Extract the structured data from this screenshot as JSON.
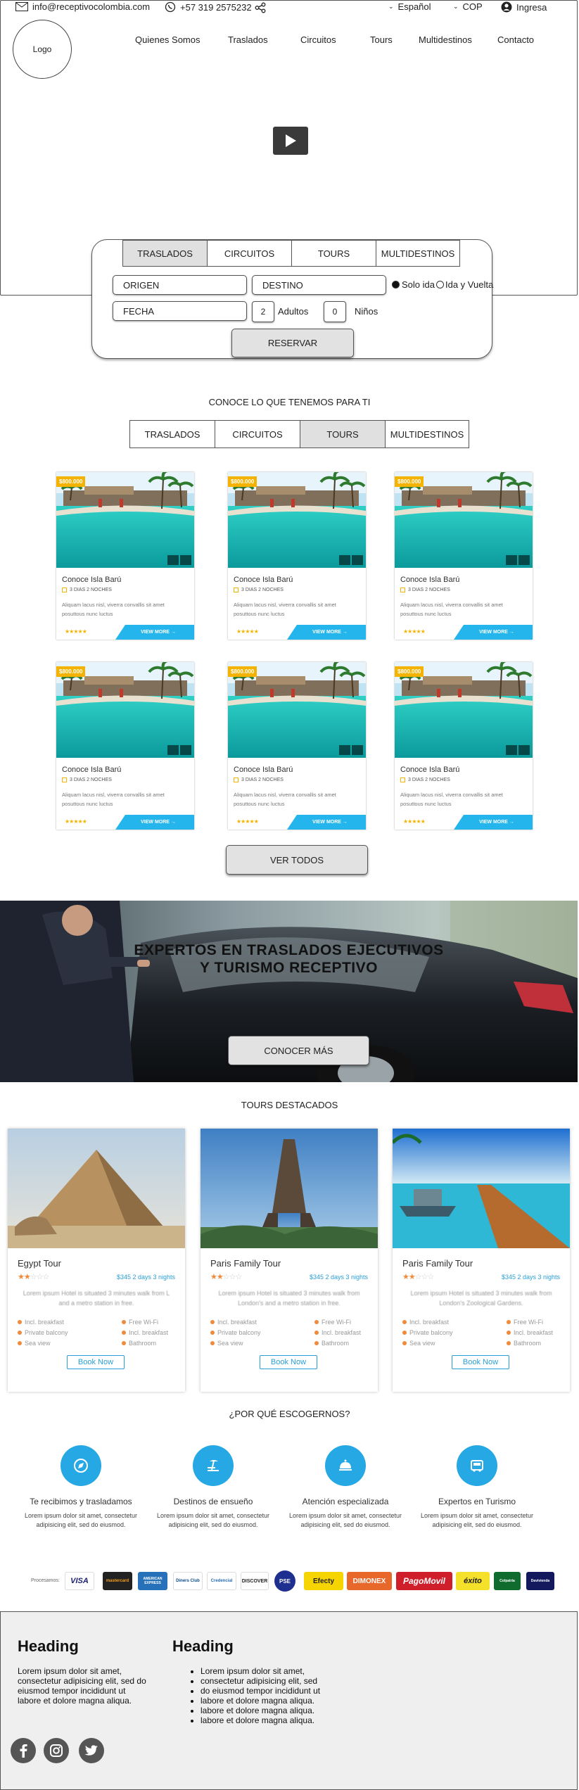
{
  "header": {
    "email": "info@receptivocolombia.com",
    "phone": "+57 319 2575232",
    "language": "Español",
    "currency": "COP",
    "login": "Ingresa",
    "logo_text": "Logo"
  },
  "nav": {
    "items": [
      "Quienes Somos",
      "Traslados",
      "Circuitos",
      "Tours",
      "Multidestinos",
      "Contacto"
    ]
  },
  "booking": {
    "tabs": [
      {
        "label": "TRASLADOS",
        "active": true
      },
      {
        "label": "CIRCUITOS",
        "active": false
      },
      {
        "label": "TOURS",
        "active": false
      },
      {
        "label": "MULTIDESTINOS",
        "active": false
      }
    ],
    "origin_placeholder": "ORIGEN",
    "destination_placeholder": "DESTINO",
    "date_placeholder": "FECHA",
    "trip_type": {
      "one_way": "Solo ida",
      "round_trip": "Ida y Vuelta",
      "selected": "Solo ida"
    },
    "adults_value": "2",
    "adults_label": "Adultos",
    "children_value": "0",
    "children_label": "Niños",
    "submit_label": "RESERVAR"
  },
  "products": {
    "section_title": "CONOCE LO QUE TENEMOS PARA TI",
    "tabs": [
      {
        "label": "TRASLADOS",
        "active": false
      },
      {
        "label": "CIRCUITOS",
        "active": false
      },
      {
        "label": "TOURS",
        "active": true
      },
      {
        "label": "MULTIDESTINOS",
        "active": false
      }
    ],
    "cards": [
      {
        "price": "$800.000",
        "title": "Conoce Isla Barú",
        "duration": "3 DIAS 2 NOCHES",
        "description": "Aliquam lacus nisl, viverra convallis sit amet posuttous nunc luctus",
        "rating": 5,
        "cta": "VIEW MORE →"
      },
      {
        "price": "$800.000",
        "title": "Conoce Isla Barú",
        "duration": "3 DIAS 2 NOCHES",
        "description": "Aliquam lacus nisl, viverra convallis sit amet posuttous nunc luctus",
        "rating": 5,
        "cta": "VIEW MORE →"
      },
      {
        "price": "$800.000",
        "title": "Conoce Isla Barú",
        "duration": "3 DIAS 2 NOCHES",
        "description": "Aliquam lacus nisl, viverra convallis sit amet posuttous nunc luctus",
        "rating": 5,
        "cta": "VIEW MORE →"
      },
      {
        "price": "$800.000",
        "title": "Conoce Isla Barú",
        "duration": "3 DIAS 2 NOCHES",
        "description": "Aliquam lacus nisl, viverra convallis sit amet posuttous nunc luctus",
        "rating": 5,
        "cta": "VIEW MORE →"
      },
      {
        "price": "$800.000",
        "title": "Conoce Isla Barú",
        "duration": "3 DIAS 2 NOCHES",
        "description": "Aliquam lacus nisl, viverra convallis sit amet posuttous nunc luctus",
        "rating": 5,
        "cta": "VIEW MORE →"
      },
      {
        "price": "$800.000",
        "title": "Conoce Isla Barú",
        "duration": "3 DIAS 2 NOCHES",
        "description": "Aliquam lacus nisl, viverra convallis sit amet posuttous nunc luctus",
        "rating": 5,
        "cta": "VIEW MORE →"
      }
    ],
    "view_all_label": "VER TODOS"
  },
  "banner": {
    "title_line1": "EXPERTOS EN TRASLADOS EJECUTIVOS",
    "title_line2": "Y TURISMO RECEPTIVO",
    "cta": "CONOCER MÁS"
  },
  "featured_tours": {
    "section_title": "TOURS DESTACADOS",
    "cards": [
      {
        "title": "Egypt Tour",
        "price": "$345 2 days 3 nights",
        "rating": 2,
        "description": "Lorem ipsum Hotel is situated 3 minutes walk from L and a metro station in free.",
        "features": [
          "Incl. breakfast",
          "Free Wi-Fi",
          "Private balcony",
          "Incl. breakfast",
          "Sea view",
          "Bathroom"
        ],
        "cta": "Book Now"
      },
      {
        "title": "Paris Family Tour",
        "price": "$345 2 days 3 nights",
        "rating": 2,
        "description": "Lorem ipsum Hotel is situated 3 minutes walk from London's and a metro station in free.",
        "features": [
          "Incl. breakfast",
          "Free Wi-Fi",
          "Private balcony",
          "Incl. breakfast",
          "Sea view",
          "Bathroom"
        ],
        "cta": "Book Now"
      },
      {
        "title": "Paris Family Tour",
        "price": "$345 2 days 3 nights",
        "rating": 2,
        "description": "Lorem ipsum Hotel is situated 3 minutes walk from London's Zoological Gardens.",
        "features": [
          "Incl. breakfast",
          "Free Wi-Fi",
          "Private balcony",
          "Incl. breakfast",
          "Sea view",
          "Bathroom"
        ],
        "cta": "Book Now"
      }
    ]
  },
  "why_us": {
    "section_title": "¿POR QUÉ ESCOGERNOS?",
    "items": [
      {
        "title": "Te recibimos y trasladamos",
        "text": "Lorem ipsum dolor sit amet, consectetur adipisicing elit, sed do eiusmod.",
        "icon": "compass-icon"
      },
      {
        "title": "Destinos de ensueño",
        "text": "Lorem ipsum dolor sit amet, consectetur adipisicing elit, sed do eiusmod.",
        "icon": "beach-icon"
      },
      {
        "title": "Atención especializada",
        "text": "Lorem ipsum dolor sit amet, consectetur adipisicing elit, sed do eiusmod.",
        "icon": "service-bell-icon"
      },
      {
        "title": "Expertos en Turismo",
        "text": "Lorem ipsum dolor sit amet, consectetur adipisicing elit, sed do eiusmod.",
        "icon": "bus-icon"
      }
    ]
  },
  "payments": {
    "label": "Procesamos:",
    "methods": [
      "VISA",
      "mastercard",
      "AMERICAN EXPRESS",
      "Diners Club",
      "Credencial",
      "DISCOVER",
      "PSE",
      "Efecty",
      "DIMONEX",
      "PagoMovil",
      "éxito",
      "Colpatria",
      "Davivienda"
    ]
  },
  "footer": {
    "col1": {
      "heading": "Heading",
      "text": "Lorem ipsum dolor sit amet, consectetur adipisicing elit, sed do eiusmod tempor incididunt ut labore et dolore magna aliqua."
    },
    "col2": {
      "heading": "Heading",
      "list": [
        "Lorem ipsum dolor sit amet,",
        "consectetur adipisicing elit, sed",
        "do eiusmod tempor incididunt ut",
        "labore et dolore magna aliqua.",
        "labore et dolore magna aliqua.",
        "labore et dolore magna aliqua."
      ]
    },
    "social": [
      "facebook-icon",
      "instagram-icon",
      "twitter-icon"
    ]
  },
  "colors": {
    "accent": "#26a8e5",
    "price_tag": "#f3b300",
    "view_more": "#23b5ec",
    "feature_dot": "#f08a3c"
  }
}
